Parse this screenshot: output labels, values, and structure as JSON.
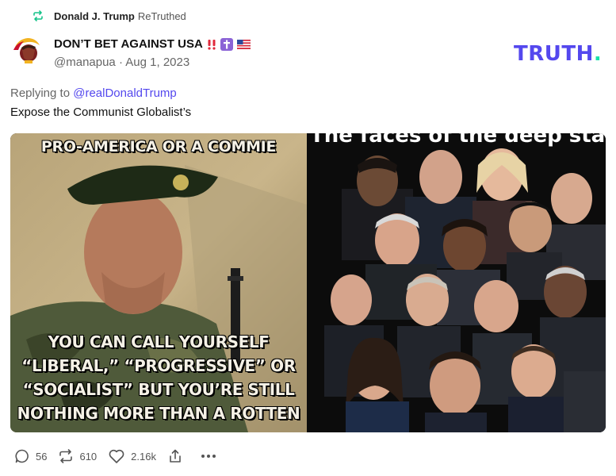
{
  "retruth": {
    "name": "Donald J. Trump",
    "suffix": "ReTruthed",
    "icon": "retruth-icon",
    "icon_color": "#17c38a"
  },
  "post": {
    "display_name": "DON’T BET AGAINST USA",
    "badges": [
      "double-exclamation-icon",
      "latin-cross-icon",
      "us-flag-icon"
    ],
    "handle": "@manapua",
    "date": "Aug 1, 2023",
    "replying_prefix": "Replying to",
    "replying_to": "@realDonaldTrump",
    "text": "Expose the Communist Globalist’s"
  },
  "brand": {
    "logo_text": "TRUTH",
    "logo_dot": ".",
    "primary_color": "#5448ee",
    "accent_color": "#17e0a8"
  },
  "media": {
    "left_meme": {
      "top_text": "PRO-AMERICA OR A COMMIE",
      "bottom_lines": [
        "YOU CAN CALL YOURSELF",
        "“LIBERAL,” “PROGRESSIVE” OR",
        "“SOCIALIST” BUT YOU’RE STILL",
        "NOTHING MORE THAN A ROTTEN"
      ]
    },
    "right_collage": {
      "title": "The faces of the deep state"
    }
  },
  "actions": {
    "replies": "56",
    "retruths": "610",
    "likes": "2.16k"
  }
}
